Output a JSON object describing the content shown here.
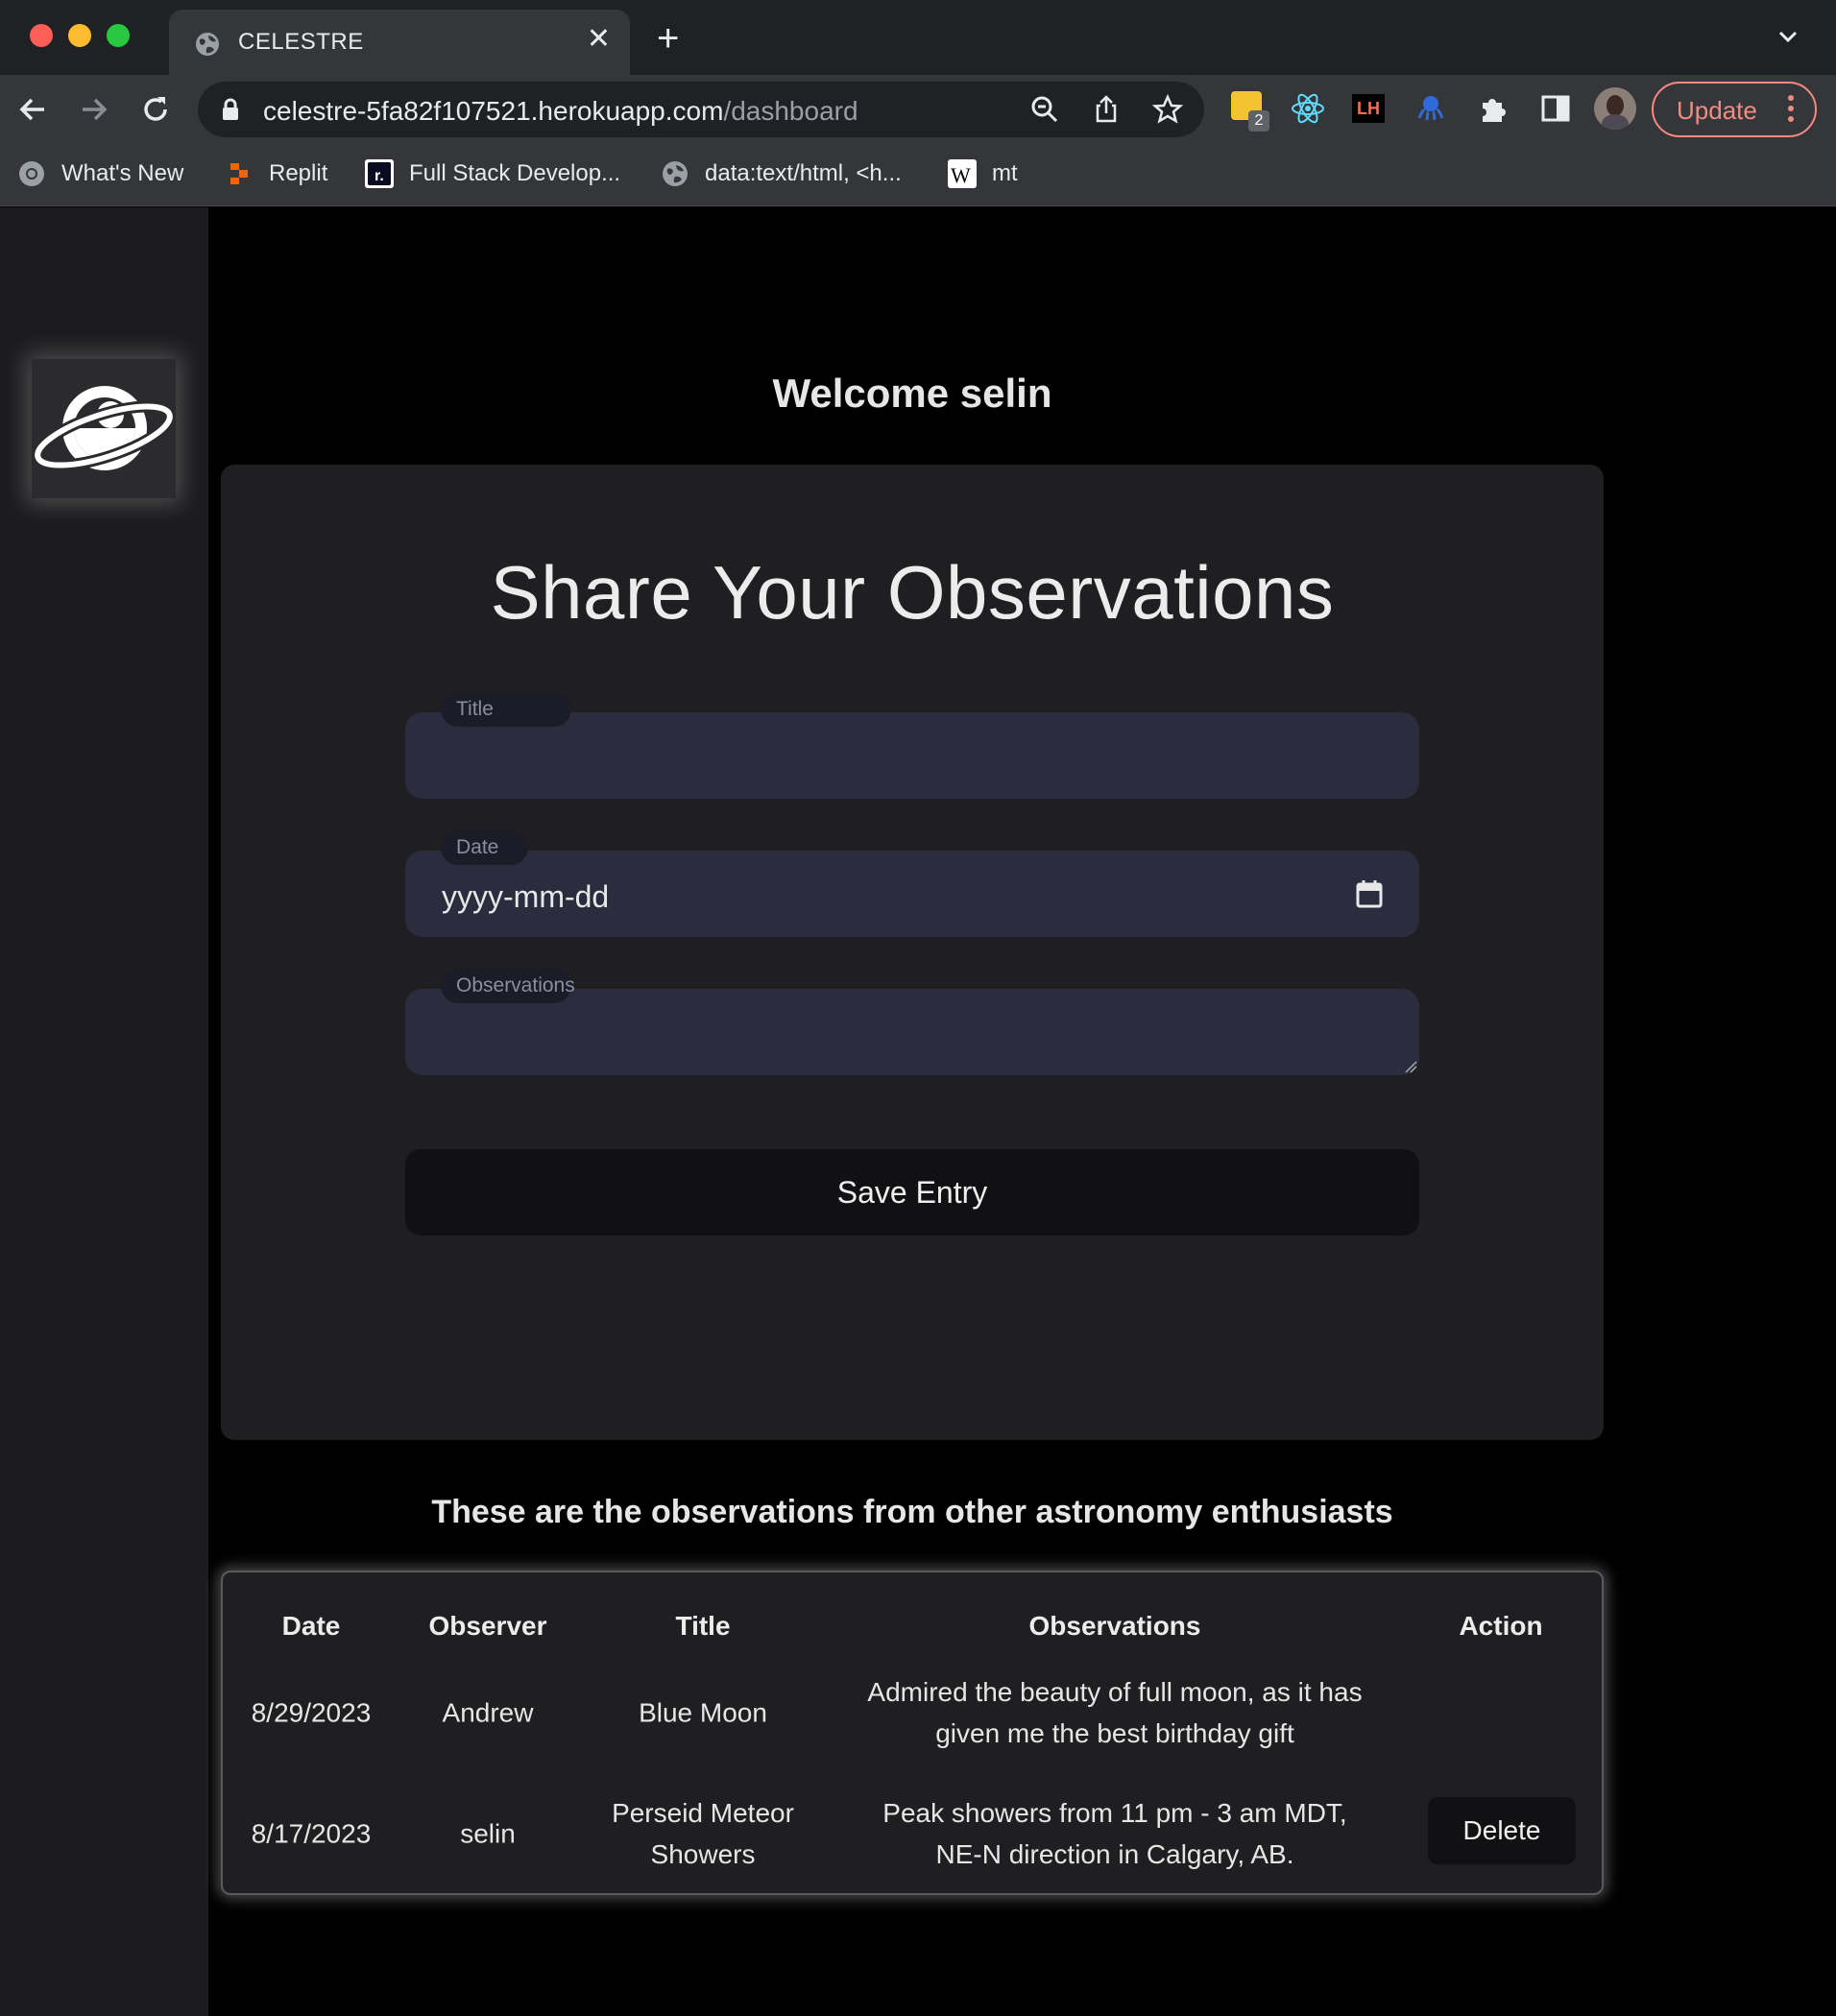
{
  "browser": {
    "tab_title": "CELESTRE",
    "url_host": "celestre-5fa82f107521.herokuapp.com",
    "url_path": "/dashboard",
    "update_label": "Update",
    "extension_badge": "2",
    "lighthouse_label": "LH",
    "bookmarks": [
      {
        "label": "What's New",
        "icon": "chrome-icon"
      },
      {
        "label": "Replit",
        "icon": "replit-icon"
      },
      {
        "label": "Full Stack Develop...",
        "icon": "freecodecamp-icon"
      },
      {
        "label": "data:text/html, <h...",
        "icon": "globe-icon"
      },
      {
        "label": "mt",
        "icon": "wikipedia-icon"
      }
    ]
  },
  "page": {
    "welcome": "Welcome selin",
    "form": {
      "heading": "Share Your Observations",
      "title_label": "Title",
      "title_value": "",
      "date_label": "Date",
      "date_placeholder": "yyyy-mm-dd",
      "observations_label": "Observations",
      "observations_value": "",
      "save_label": "Save Entry"
    },
    "table_heading": "These are the observations from other astronomy enthusiasts",
    "table": {
      "columns": [
        "Date",
        "Observer",
        "Title",
        "Observations",
        "Action"
      ],
      "rows": [
        {
          "date": "8/29/2023",
          "observer": "Andrew",
          "title": "Blue Moon",
          "observations_line1": "Admired the beauty of full moon, as it has",
          "observations_line2": "given me the best birthday gift",
          "action": ""
        },
        {
          "date": "8/17/2023",
          "observer": "selin",
          "title_line1": "Perseid Meteor",
          "title_line2": "Showers",
          "observations_line1": "Peak showers from 11 pm - 3 am MDT,",
          "observations_line2": "NE-N direction in Calgary, AB.",
          "action": "Delete"
        }
      ]
    }
  },
  "colors": {
    "page_bg": "#000000",
    "sidebar_bg": "#1c1c1e",
    "card_bg": "#1f1f21",
    "field_bg": "#2b2d3e",
    "update_accent": "#f28b82"
  }
}
